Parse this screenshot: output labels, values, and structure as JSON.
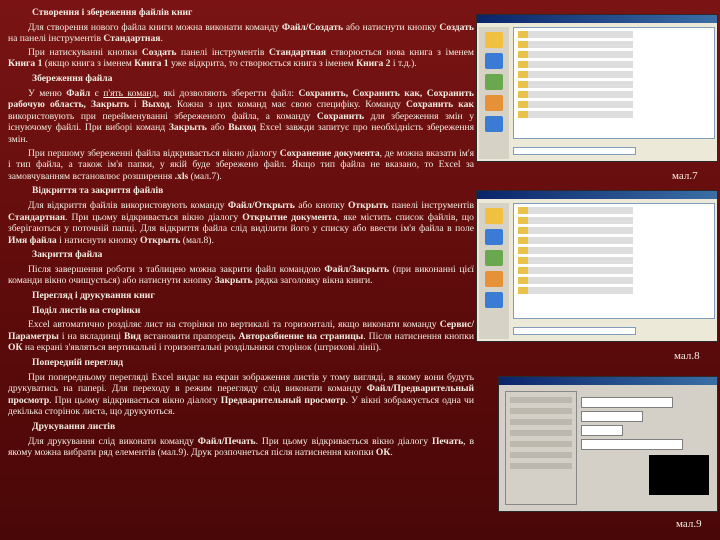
{
  "sections": [
    {
      "kind": "h",
      "text": "Створення і збереження файлів книг"
    },
    {
      "kind": "p",
      "html": "Для створення нового файла книги можна виконати команду <b>Файл/Создать</b> або натиснути кнопку <b>Создать</b> на панелі інструментів <b>Стандартная</b>."
    },
    {
      "kind": "p",
      "html": "При натискуванні кнопки <b>Создать</b> панелі інструментів <b>Стандартная</b> створюється нова книга з іменем <b>Книга 1</b> (якщо книга з іменем <b>Книга 1</b> уже відкрита, то створюється книга з іменем <b>Книга 2</b> і т.д.)."
    },
    {
      "kind": "h",
      "text": "Збереження файла"
    },
    {
      "kind": "p",
      "html": "У меню <b>Файл</b> є <span class=\"u\">п'ять команд</span>, які дозволяють зберегти файл: <b>Сохранить, Сохранить как, Сохранить рабочую область, Закрыть</b> і <b>Выход</b>. Кожна з цих команд має свою специфіку. Команду <b>Сохранить как</b> використовують при перейменуванні збереженого файла, а команду <b>Сохранить</b> для збереження змін у існуючому файлі. При виборі команд <b>Закрыть</b> або <b>Выход</b> Excel завжди запитує про необхідність збереження змін."
    },
    {
      "kind": "p",
      "html": "При першому збереженні файла відкривається вікно діалогу <b>Сохранение документа</b>, де можна вказати ім'я і тип файла, а також ім'я папки, у якій буде збережено файл. Якщо тип файла не вказано, то Excel за замовчуванням встановлює розширення <b>.xls</b> (мал.7)."
    },
    {
      "kind": "h",
      "text": "Відкриття та закриття файлів"
    },
    {
      "kind": "p",
      "html": "Для відкриття файлів використовують команду <b>Файл/Открыть</b> або кнопку <b>Открыть</b> панелі інструментів <b>Стандартная</b>. При цьому відкривається вікно діалогу <b>Открытие документа</b>, яке містить список файлів, що зберігаються у поточній папці. Для відкриття файла слід виділити його у списку або ввести ім'я файла в поле <b>Имя файла</b> і натиснути кнопку <b>Открыть</b> (мал.8)."
    },
    {
      "kind": "h",
      "text": "Закриття файла"
    },
    {
      "kind": "p",
      "html": "Після завершення роботи з таблицею можна закрити файл командою <b>Файл/Закрыть</b> (при виконанні цієї команди вікно очищується) або натиснути кнопку <b>Закрыть</b> рядка заголовку вікна книги."
    },
    {
      "kind": "h",
      "text": "Перегляд і друкування книг"
    },
    {
      "kind": "h",
      "text": "Поділ листів на сторінки"
    },
    {
      "kind": "p",
      "html": "Excel автоматично розділяє лист на сторінки по вертикалі та горизонталі, якщо виконати команду <b>Сервис/Параметры</b> і на вкладинці <b>Вид</b> встановити прапорець <b>Авторазбиение на страницы</b>. Після натиснення кнопки <b>ОК</b> на екрані з'являться вертикальні і горизонтальні роздільники сторінок (штрихові лінії)."
    },
    {
      "kind": "h",
      "text": "Попередній перегляд"
    },
    {
      "kind": "p",
      "html": "При попередньому перегляді Excel видає на екран зображення листів у тому вигляді, в якому вони будуть друкуватись на папері. Для переходу в режим перегляду слід виконати команду <b>Файл/Предварительный просмотр</b>. При цьому відкривається вікно діалогу <b>Предварительный просмотр</b>. У вікні зображується одна чи декілька сторінок листа, що друкуються."
    },
    {
      "kind": "h",
      "text": "Друкування листів"
    },
    {
      "kind": "p",
      "html": "Для друкування слід виконати команду <b>Файл/Печать</b>. При цьому відкривається вікно діалогу <b>Печать</b>, в якому можна вибрати ряд елементів (мал.9). Друк розпочнеться після натиснення кнопки <b>ОК</b>."
    }
  ],
  "captions": {
    "fig7": "мал.7",
    "fig8": "мал.8",
    "fig9": "мал.9"
  },
  "colors": {
    "background": "#6b0f0f",
    "text": "#f3ece2"
  }
}
